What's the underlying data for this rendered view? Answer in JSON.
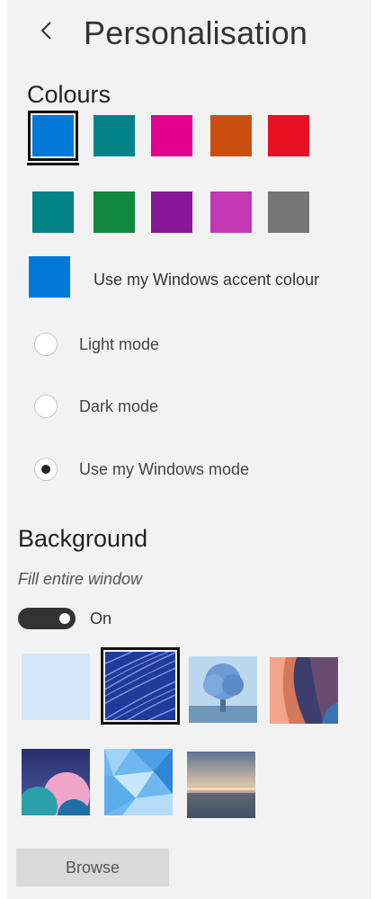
{
  "header": {
    "title": "Personalisation"
  },
  "colours": {
    "heading": "Colours",
    "swatches": [
      "#0078d7",
      "#038387",
      "#e3008c",
      "#ca5010",
      "#e81123",
      "#038387",
      "#10893e",
      "#881798",
      "#c239b3",
      "#767676"
    ],
    "selected_index": 0,
    "accent_swatch": "#0078d7",
    "accent_label": "Use my Windows accent colour"
  },
  "mode": {
    "options": [
      {
        "label": "Light mode",
        "selected": false
      },
      {
        "label": "Dark mode",
        "selected": false
      },
      {
        "label": "Use my Windows mode",
        "selected": true
      }
    ]
  },
  "background": {
    "heading": "Background",
    "fill_label": "Fill entire window",
    "toggle_state": "On",
    "toggle_on": true,
    "thumbnails": [
      "plain-light-blue",
      "blue-streaks",
      "blue-tree",
      "canyon",
      "pink-planet",
      "blue-polygons",
      "sunset-sea"
    ],
    "selected_thumbnail": 1
  },
  "browse_label": "Browse"
}
